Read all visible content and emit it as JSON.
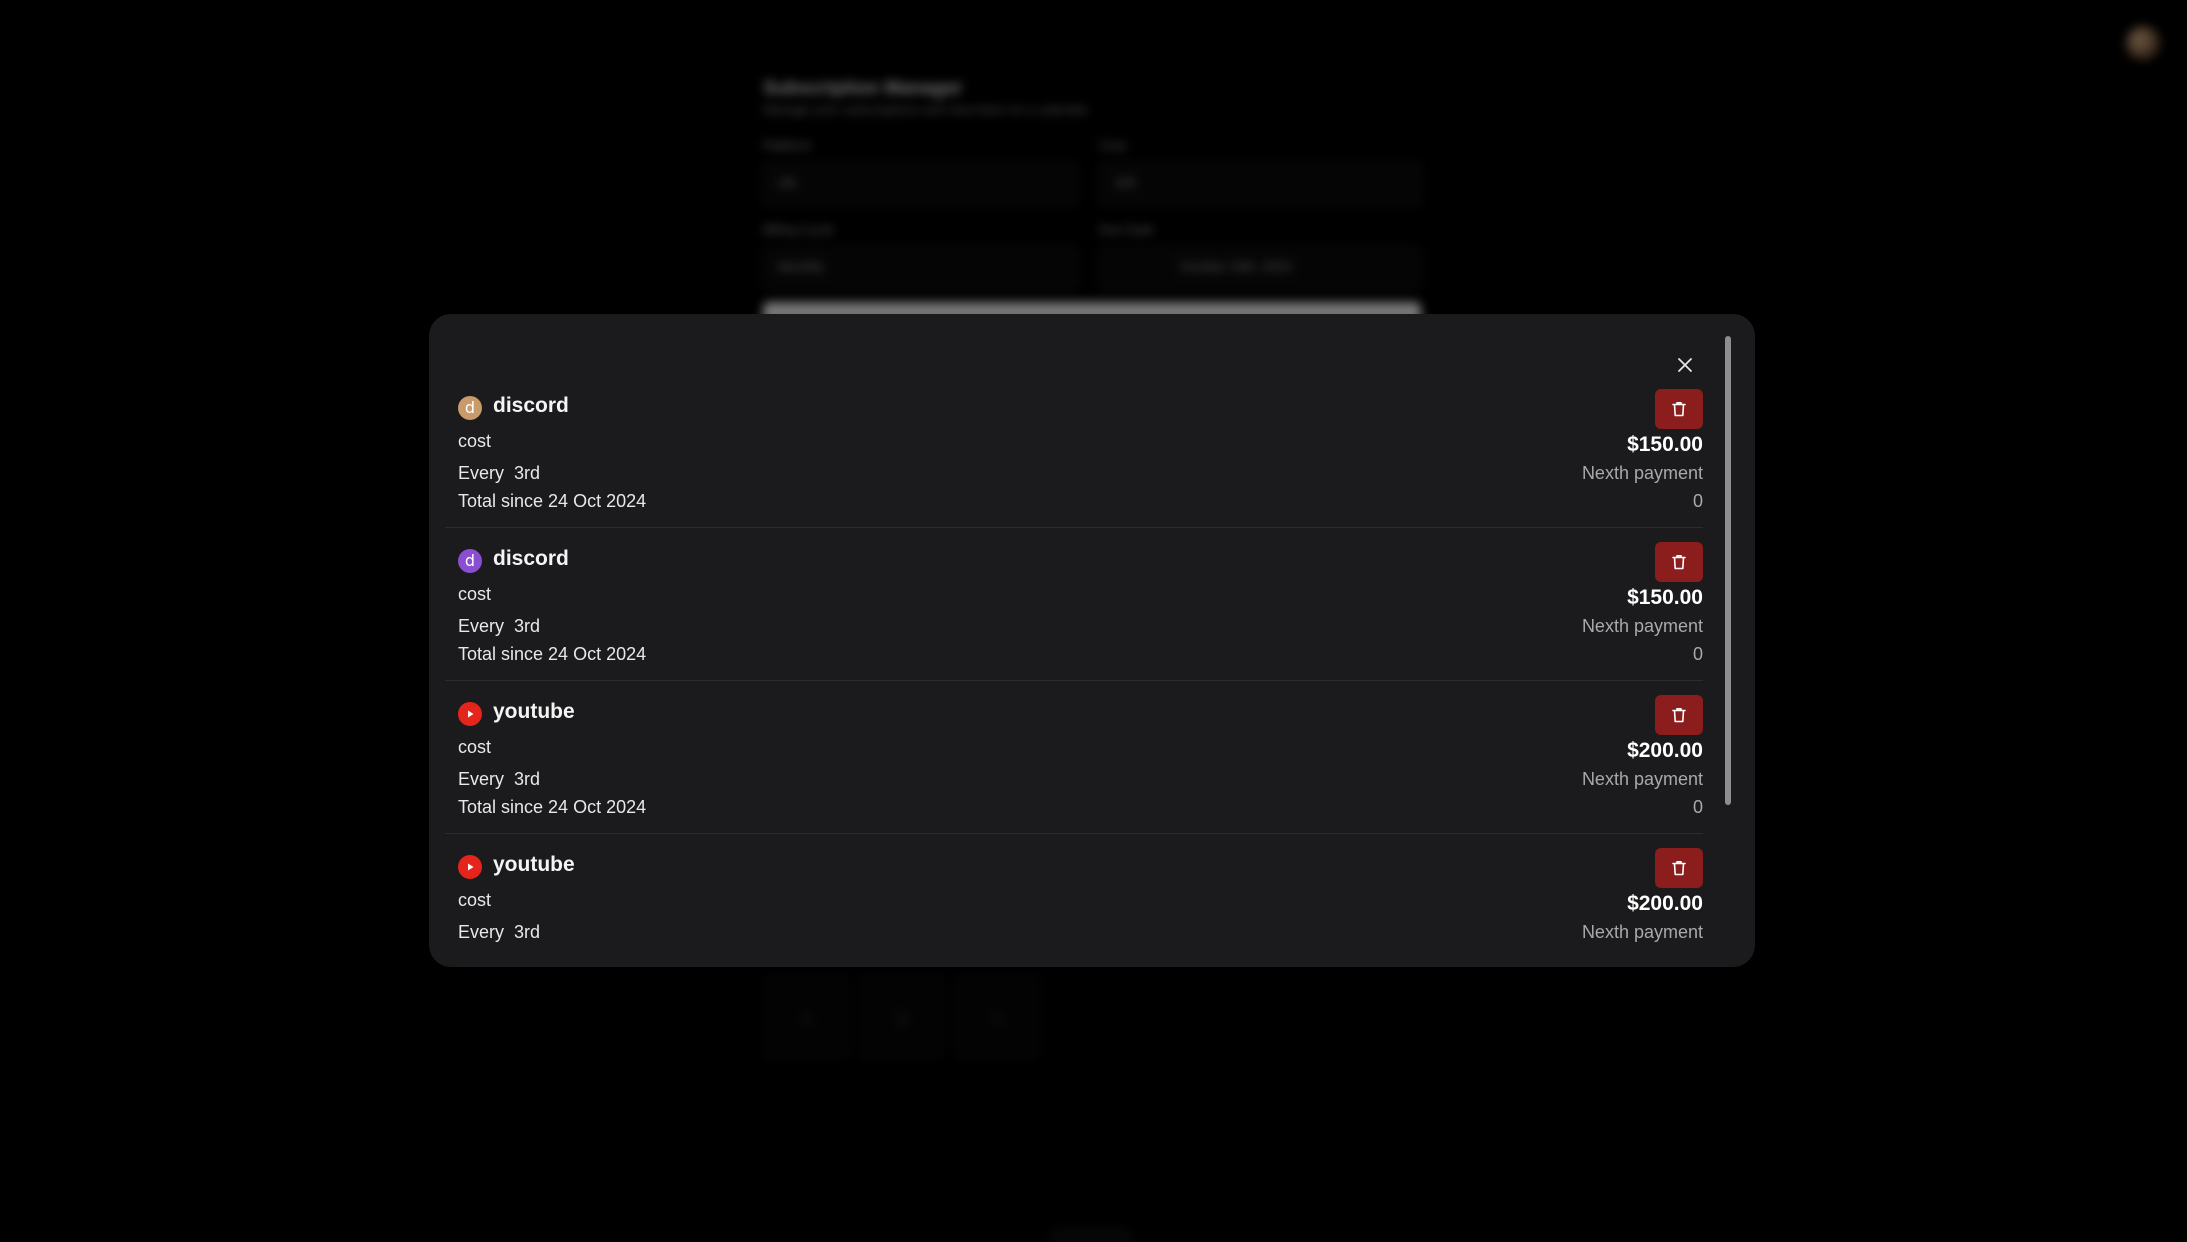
{
  "background": {
    "title": "Subscription Manager",
    "subtitle": "Manage your subscriptions and view them on a calendar",
    "platform_label": "Platform",
    "platform_value": "nfa",
    "cost_label": "Cost",
    "cost_value": "100",
    "billing_cycle_label": "Billing Cycle",
    "billing_cycle_value": "Monthly",
    "due_date_label": "Due Date",
    "due_date_value": "October 24th, 2024",
    "pager": [
      "<",
      "1",
      ">"
    ]
  },
  "modal": {
    "close_icon": "close-icon",
    "subscriptions": [
      {
        "name": "discord",
        "logo_letter": "d",
        "logo_color": "#c99a6a",
        "cost_label": "cost",
        "price": "$150.00",
        "cycle_prefix": "Every",
        "cycle_day": "3rd",
        "next_payment_label": "Nexth payment",
        "total_label": "Total since 24 Oct 2024",
        "total_value": "0"
      },
      {
        "name": "discord",
        "logo_letter": "d",
        "logo_color": "#8a4fd0",
        "cost_label": "cost",
        "price": "$150.00",
        "cycle_prefix": "Every",
        "cycle_day": "3rd",
        "next_payment_label": "Nexth payment",
        "total_label": "Total since 24 Oct 2024",
        "total_value": "0"
      },
      {
        "name": "youtube",
        "logo_icon": "youtube-play-icon",
        "logo_color": "#e5241b",
        "cost_label": "cost",
        "price": "$200.00",
        "cycle_prefix": "Every",
        "cycle_day": "3rd",
        "next_payment_label": "Nexth payment",
        "total_label": "Total since 24 Oct 2024",
        "total_value": "0"
      },
      {
        "name": "youtube",
        "logo_icon": "youtube-play-icon",
        "logo_color": "#e5241b",
        "cost_label": "cost",
        "price": "$200.00",
        "cycle_prefix": "Every",
        "cycle_day": "3rd",
        "next_payment_label": "Nexth payment",
        "total_label": "",
        "total_value": ""
      }
    ]
  },
  "colors": {
    "delete_button": "#8b1d1d",
    "modal_background": "#1b1b1d"
  }
}
